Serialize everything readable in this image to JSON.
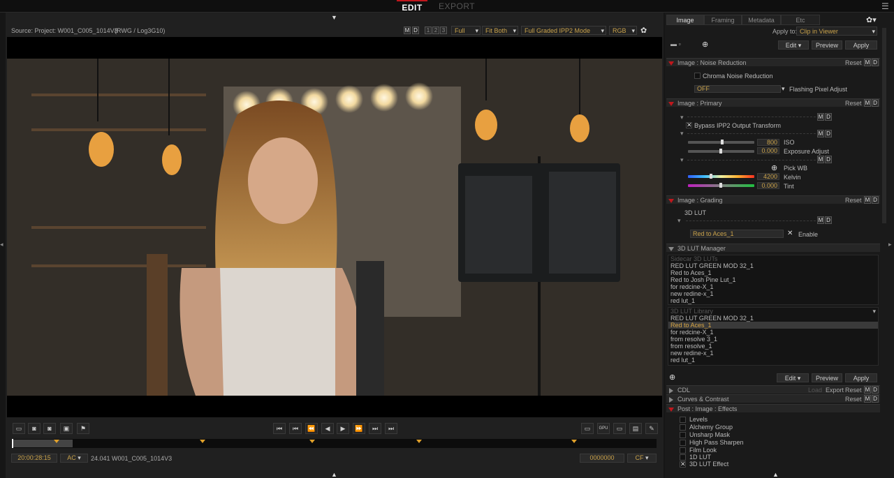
{
  "top": {
    "edit_tab": "EDIT",
    "export_tab": "EXPORT",
    "menu_icon": "☰"
  },
  "viewer": {
    "source_label": "Source: Project: W001_C005_1014V3",
    "colorspace": "(RWG / Log3G10)",
    "m": "M",
    "d": "D",
    "n1": "1",
    "n2": "2",
    "n3": "3",
    "quality": "Full",
    "fit": "Fit Both",
    "mode": "Full Graded IPP2 Mode",
    "channel": "RGB",
    "gear": "✿"
  },
  "transport": {
    "buttons": [
      "⏮",
      "⏮",
      "⏪",
      "◀",
      "▶",
      "⏩",
      "⏭",
      "⏭"
    ],
    "timecode": "20:00:28:15",
    "tc_mode": "AC",
    "clip_info": "24.041 W001_C005_1014V3",
    "frame": "0000000",
    "frame_mode": "CF"
  },
  "panel": {
    "tabs": [
      "Image",
      "Framing",
      "Metadata",
      "Etc"
    ],
    "apply_to_label": "Apply to:",
    "apply_to_value": "Clip in Viewer",
    "edit": "Edit",
    "preview": "Preview",
    "apply": "Apply",
    "noise": {
      "title": "Image : Noise Reduction",
      "reset": "Reset",
      "chroma": "Chroma Noise Reduction",
      "fpa_value": "OFF",
      "fpa_label": "Flashing Pixel Adjust"
    },
    "primary": {
      "title": "Image : Primary",
      "reset": "Reset",
      "bypass": "Bypass IPP2 Output Transform",
      "iso_value": "800",
      "iso_label": "ISO",
      "exposure_value": "0.000",
      "exposure_label": "Exposure Adjust",
      "pick_wb": "Pick WB",
      "kelvin_value": "4200",
      "kelvin_label": "Kelvin",
      "tint_value": "0.000",
      "tint_label": "Tint"
    },
    "grading": {
      "title": "Image : Grading",
      "reset": "Reset",
      "lut_label": "3D LUT",
      "lut_value": "Red to Aces_1",
      "enable": "Enable"
    },
    "lut_manager": {
      "title": "3D LUT Manager",
      "sidecar_header": "Sidecar 3D LUTs",
      "sidecar": [
        "RED LUT GREEN MOD 32_1",
        "Red to Aces_1",
        "Red to Josh Pine Lut_1",
        "for redcine-X_1",
        "new redine-x_1",
        "red lut_1"
      ],
      "library_header": "3D LUT Library",
      "library": [
        "RED LUT GREEN MOD 32_1",
        "Red to Aces_1",
        "for redcine-X_1",
        "from resolve 3_1",
        "from resolve_1",
        "new redine-x_1",
        "red lut_1"
      ],
      "edit": "Edit",
      "preview": "Preview",
      "apply": "Apply"
    },
    "cdl": {
      "title": "CDL",
      "load": "Load",
      "export": "Export",
      "reset": "Reset"
    },
    "curves": {
      "title": "Curves & Contrast",
      "reset": "Reset"
    },
    "effects": {
      "title": "Post : Image : Effects",
      "items": [
        "Levels",
        "Alchemy Group",
        "Unsharp Mask",
        "High Pass Sharpen",
        "Film Look",
        "1D LUT",
        "3D LUT Effect"
      ]
    },
    "md_m": "M",
    "md_d": "D"
  }
}
